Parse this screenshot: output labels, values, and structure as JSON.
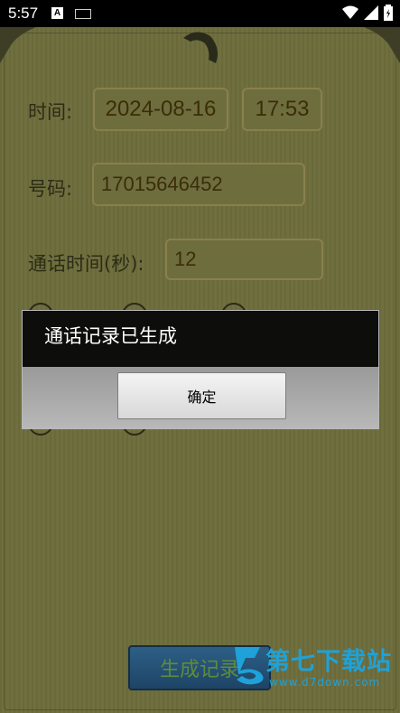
{
  "status_bar": {
    "time": "5:57",
    "icon_a": "A"
  },
  "form": {
    "time_label": "时间:",
    "date_value": "2024-08-16",
    "clock_value": "17:53",
    "number_label": "号码:",
    "number_value": "17015646452",
    "duration_label": "通话时间(秒):",
    "duration_value": "12"
  },
  "dialog": {
    "message": "通话记录已生成",
    "ok_label": "确定"
  },
  "generate_button": {
    "label": "生成记录"
  },
  "watermark": {
    "name": "第七下载站",
    "url": "www.d7down.com"
  },
  "colors": {
    "background": "#6d6c3c",
    "dialog_title_bg": "#0d0d0c",
    "button_bg": "#2d5f86",
    "watermark": "#1ea2d8"
  }
}
